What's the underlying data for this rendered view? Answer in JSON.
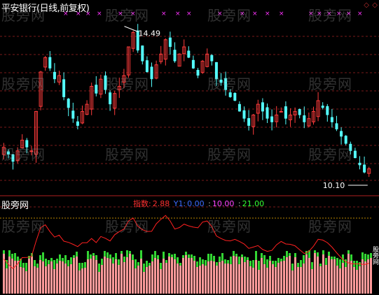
{
  "window": {
    "title": "平安银行(日线,前复权)",
    "watermark": "股旁网",
    "side_label": "股旁网",
    "ctrl_a": "◇",
    "ctrl_b": "◇"
  },
  "colors": {
    "background": "#000000",
    "up": "#ff3b3b",
    "down": "#54ffff",
    "grid": "#7a1a1a",
    "signal_line": "#ff2020",
    "dotted_line": "#bb8800",
    "hist_top": "#33d633",
    "hist_body": "#ff9a9a",
    "magenta_marker": "#ff33ff"
  },
  "indicator": {
    "panel_title": "股旁网",
    "name_label": "指数:",
    "value": "2.88",
    "y1_label": "Y1:",
    "y1_value": "0.00",
    "level_a": "10.00",
    "level_b": "21.00"
  },
  "chart_data": {
    "type": "candlestick",
    "title": "平安银行(日线,前复权)",
    "annotations": [
      {
        "text": "14.49",
        "kind": "high"
      },
      {
        "text": "10.10",
        "kind": "low"
      }
    ],
    "ohlc_close": [
      11.0,
      10.8,
      10.6,
      10.9,
      11.2,
      11.0,
      10.9,
      12.0,
      13.1,
      13.5,
      13.2,
      12.9,
      13.0,
      12.4,
      12.1,
      11.8,
      11.6,
      12.0,
      12.2,
      12.7,
      12.5,
      12.9,
      12.6,
      12.2,
      12.5,
      12.7,
      13.0,
      13.8,
      14.2,
      13.7,
      13.4,
      13.1,
      12.9,
      13.3,
      13.6,
      14.0,
      13.8,
      13.4,
      13.6,
      13.8,
      13.5,
      13.2,
      13.0,
      13.4,
      13.6,
      13.4,
      12.9,
      12.8,
      12.6,
      12.4,
      12.3,
      12.0,
      11.8,
      11.6,
      11.9,
      12.2,
      12.0,
      11.8,
      11.7,
      11.9,
      12.0,
      11.8,
      11.9,
      12.0,
      11.9,
      11.7,
      11.8,
      12.0,
      12.3,
      12.1,
      11.9,
      11.7,
      11.5,
      11.3,
      11.1,
      10.9,
      10.7,
      10.5,
      10.3,
      10.4
    ],
    "indicator_line_note": "oscillator",
    "levels": [
      10.0,
      21.0
    ],
    "grid": true
  }
}
